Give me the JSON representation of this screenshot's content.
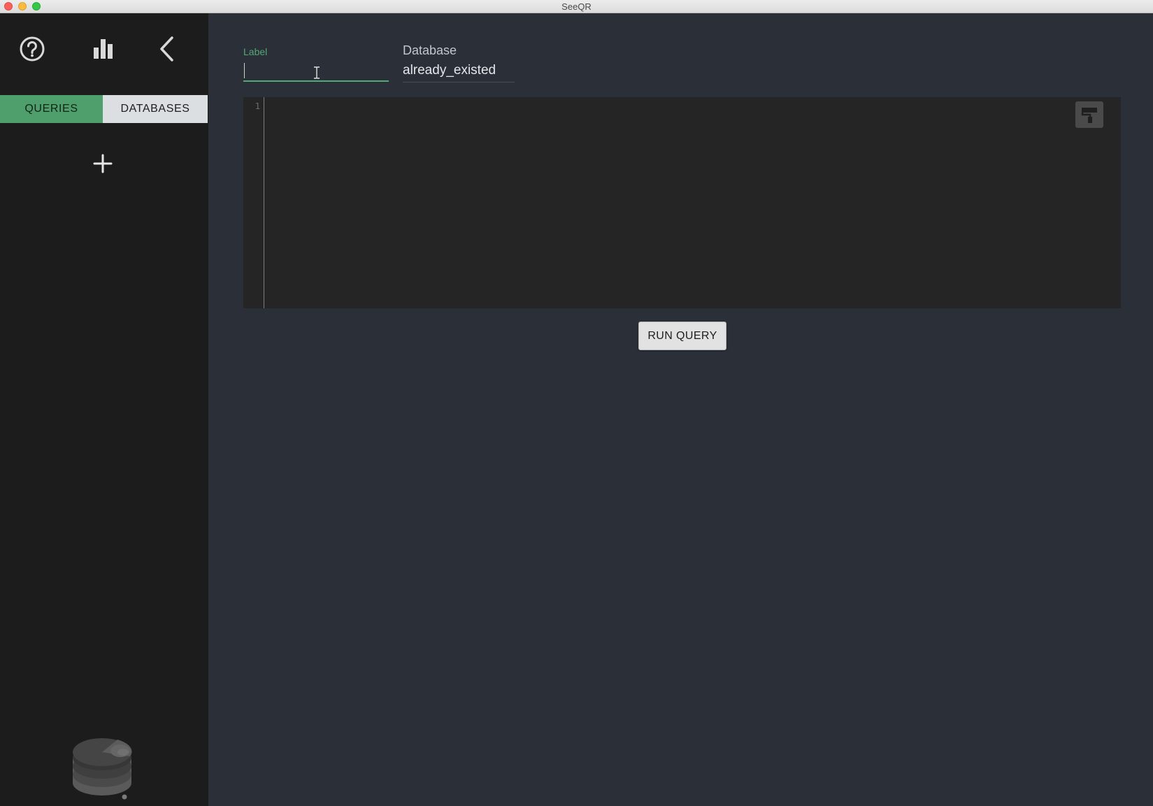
{
  "window": {
    "title": "SeeQR"
  },
  "sidebar": {
    "icons": [
      "help-circle-icon",
      "bar-chart-icon",
      "chevron-left-icon",
      "plus-icon",
      "database-logo-icon"
    ],
    "tabs": [
      {
        "label": "QUERIES",
        "active": true
      },
      {
        "label": "DATABASES",
        "active": false
      }
    ]
  },
  "query_form": {
    "label_caption": "Label",
    "label_value": "",
    "database_caption": "Database",
    "database_value": "already_existed"
  },
  "editor": {
    "line_numbers": [
      "1"
    ],
    "content": ""
  },
  "actions": {
    "run_query_label": "RUN QUERY"
  },
  "colors": {
    "accent_green": "#4e9f6c",
    "sidebar_bg": "#1c1c1c",
    "main_bg": "#2b2f38",
    "editor_bg": "#252525"
  }
}
